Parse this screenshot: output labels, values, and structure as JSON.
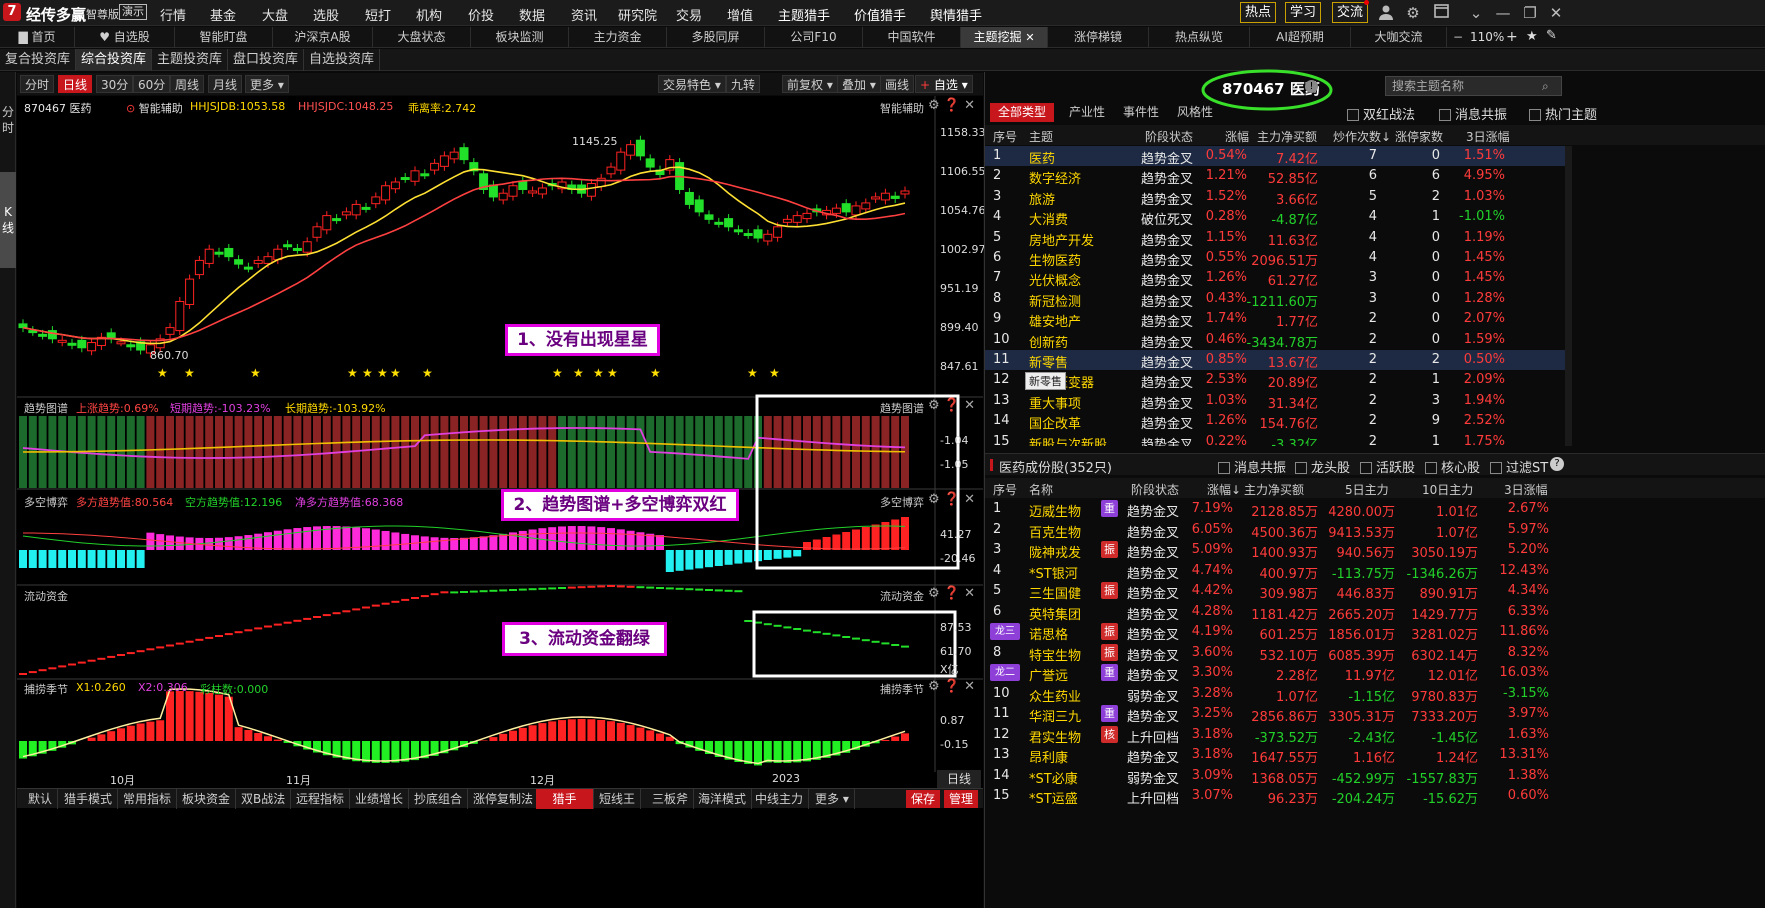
{
  "app": {
    "logo": "7",
    "name": "经传多赢",
    "edition": "智尊版",
    "demo": "演示"
  },
  "menu": [
    "行情",
    "基金",
    "大盘",
    "选股",
    "短打",
    "机构",
    "价投",
    "数据",
    "资讯",
    "研究院",
    "交易",
    "增值",
    "主题猎手",
    "价值猎手",
    "舆情猎手"
  ],
  "right_buttons": [
    "热点",
    "学习",
    "交流"
  ],
  "tabs": [
    "首页",
    "自选股",
    "智能盯盘",
    "沪深京A股",
    "大盘状态",
    "板块监测",
    "主力资金",
    "多股同屏",
    "公司F10",
    "中国软件",
    "主题挖掘",
    "涨停梯镜",
    "热点纵览",
    "AI超预期",
    "大咖交流"
  ],
  "active_tab": "主题挖掘",
  "zoom": "110%",
  "subtabs": [
    "复合投资库",
    "综合投资库",
    "主题投资库",
    "盘口投资库",
    "自选投资库"
  ],
  "active_subtab": "综合投资库",
  "left_rail": [
    "分时",
    "K线"
  ],
  "chart_toolbar": {
    "left": [
      "分时",
      "日线",
      "30分",
      "60分",
      "周线",
      "月线",
      "更多"
    ],
    "right": [
      "交易特色",
      "九转",
      "前复权",
      "叠加",
      "画线",
      "自选"
    ]
  },
  "main_panel": {
    "stock": "870467 医药",
    "assist": "智能辅助",
    "ind1": "HHJSJDB:1053.58",
    "ind2": "HHJSJDC:1048.25",
    "ind3": "乖离率:2.742",
    "title_right": "智能辅助",
    "prices": [
      "1158.33",
      "1106.55",
      "1054.76",
      "1002.97",
      "951.19",
      "899.40",
      "847.61"
    ],
    "high": "1145.25",
    "low": "860.70"
  },
  "trend_panel": {
    "name": "趋势图谱",
    "up": "上涨趋势:0.69%",
    "short": "短期趋势:-103.23%",
    "long": "长期趋势:-103.92%",
    "title_right": "趋势图谱",
    "ticks": [
      "-1.04",
      "-1.05"
    ]
  },
  "game_panel": {
    "name": "多空博弈",
    "bull": "多方趋势值:80.564",
    "bear": "空方趋势值:12.196",
    "net": "净多方趋势值:68.368",
    "title_right": "多空博弈",
    "ticks": [
      "41.27",
      "-20.46"
    ]
  },
  "flow_panel": {
    "name": "流动资金",
    "title_right": "流动资金",
    "ticks": [
      "87.53",
      "61.70"
    ],
    "unit": "X亿"
  },
  "season_panel": {
    "name": "捕捞季节",
    "x1": "X1:0.260",
    "x2": "X2:0.306",
    "bars": "彩柱数:0.000",
    "title_right": "捕捞季节",
    "ticks": [
      "0.87",
      "-0.15"
    ]
  },
  "xaxis": [
    "10月",
    "11月",
    "12月",
    "2023"
  ],
  "xaxis_right": "日线",
  "annotations": [
    "1、没有出现星星",
    "2、趋势图谱+多空博弈双红",
    "3、流动资金翻绿"
  ],
  "bottom_tabs": [
    "默认",
    "猎手模式",
    "常用指标",
    "板块资金",
    "双B战法",
    "远程指标",
    "业绩增长",
    "抄底组合",
    "涨停复制法",
    "猎手",
    "短线王",
    "三板斧",
    "海洋模式",
    "中线主力",
    "更多"
  ],
  "active_bottom_tab": "猎手",
  "bottom_buttons": [
    "保存",
    "管理"
  ],
  "right_panel": {
    "header": "870467 医药",
    "search_placeholder": "搜索主题名称",
    "filters": [
      "全部类型",
      "产业性",
      "事件性",
      "风格性"
    ],
    "checks": [
      "双红战法",
      "消息共振",
      "热门主题"
    ],
    "cols": [
      "序号",
      "主题",
      "阶段状态",
      "涨幅",
      "主力净买额",
      "炒作次数↓",
      "涨停家数",
      "3日涨幅"
    ],
    "rows": [
      [
        "1",
        "医药",
        "趋势金叉",
        "0.54%",
        "7.42亿",
        "7",
        "0",
        "1.51%"
      ],
      [
        "2",
        "数字经济",
        "趋势金叉",
        "1.21%",
        "52.85亿",
        "6",
        "6",
        "4.95%"
      ],
      [
        "3",
        "旅游",
        "趋势金叉",
        "1.52%",
        "3.66亿",
        "5",
        "2",
        "1.03%"
      ],
      [
        "4",
        "大消费",
        "破位死叉",
        "0.28%",
        "-4.87亿",
        "4",
        "1",
        "-1.01%"
      ],
      [
        "5",
        "房地产开发",
        "趋势金叉",
        "1.15%",
        "11.63亿",
        "4",
        "0",
        "1.19%"
      ],
      [
        "6",
        "生物医药",
        "趋势金叉",
        "0.55%",
        "2096.51万",
        "4",
        "0",
        "1.45%"
      ],
      [
        "7",
        "光伏概念",
        "趋势金叉",
        "1.26%",
        "61.27亿",
        "3",
        "0",
        "1.45%"
      ],
      [
        "8",
        "新冠检测",
        "趋势金叉",
        "0.43%",
        "-1211.60万",
        "3",
        "0",
        "1.28%"
      ],
      [
        "9",
        "雄安地产",
        "趋势金叉",
        "1.74%",
        "1.77亿",
        "2",
        "0",
        "2.07%"
      ],
      [
        "10",
        "创新药",
        "趋势金叉",
        "0.46%",
        "-3434.78万",
        "2",
        "0",
        "1.59%"
      ],
      [
        "11",
        "新零售",
        "趋势金叉",
        "0.85%",
        "13.67亿",
        "2",
        "2",
        "0.50%"
      ],
      [
        "12",
        "特高压变器",
        "趋势金叉",
        "2.53%",
        "20.89亿",
        "2",
        "1",
        "2.09%"
      ],
      [
        "13",
        "重大事项",
        "趋势金叉",
        "1.03%",
        "31.34亿",
        "2",
        "3",
        "1.94%"
      ],
      [
        "14",
        "国企改革",
        "趋势金叉",
        "1.26%",
        "154.76亿",
        "2",
        "9",
        "2.52%"
      ],
      [
        "15",
        "新股与次新股",
        "趋势金叉",
        "0.22%",
        "-3.32亿",
        "2",
        "1",
        "1.75%"
      ]
    ],
    "tooltip": "新零售",
    "comp_title": "医药成份股(352只)",
    "comp_checks": [
      "消息共振",
      "龙头股",
      "活跃股",
      "核心股",
      "过滤ST"
    ],
    "comp_cols": [
      "序号",
      "名称",
      "阶段状态",
      "涨幅↓",
      "主力净买额",
      "5日主力",
      "10日主力",
      "3日涨幅"
    ],
    "comp_rows": [
      [
        "1",
        "迈威生物",
        "重",
        "趋势金叉",
        "7.19%",
        "2128.85万",
        "4280.00万",
        "1.01亿",
        "2.67%"
      ],
      [
        "2",
        "百克生物",
        "",
        "趋势金叉",
        "6.05%",
        "4500.36万",
        "9413.53万",
        "1.07亿",
        "5.97%"
      ],
      [
        "3",
        "陇神戎发",
        "振",
        "趋势金叉",
        "5.09%",
        "1400.93万",
        "940.56万",
        "3050.19万",
        "5.20%"
      ],
      [
        "4",
        "*ST银河",
        "",
        "趋势金叉",
        "4.74%",
        "400.97万",
        "-113.75万",
        "-1346.26万",
        "12.43%"
      ],
      [
        "5",
        "三生国健",
        "振",
        "趋势金叉",
        "4.42%",
        "309.98万",
        "446.83万",
        "890.91万",
        "4.34%"
      ],
      [
        "6",
        "英特集团",
        "",
        "趋势金叉",
        "4.28%",
        "1181.42万",
        "2665.20万",
        "1429.77万",
        "6.33%"
      ],
      [
        "7",
        "诺思格",
        "振",
        "趋势金叉",
        "4.19%",
        "601.25万",
        "1856.01万",
        "3281.02万",
        "11.86%"
      ],
      [
        "8",
        "特宝生物",
        "振",
        "趋势金叉",
        "3.60%",
        "532.10万",
        "6085.39万",
        "6302.14万",
        "8.32%"
      ],
      [
        "9",
        "广誉远",
        "重",
        "趋势金叉",
        "3.30%",
        "2.28亿",
        "11.97亿",
        "12.01亿",
        "16.03%"
      ],
      [
        "10",
        "众生药业",
        "",
        "弱势金叉",
        "3.28%",
        "1.07亿",
        "-1.15亿",
        "9780.83万",
        "-3.15%"
      ],
      [
        "11",
        "华润三九",
        "重",
        "趋势金叉",
        "3.25%",
        "2856.86万",
        "3305.31万",
        "7333.20万",
        "3.97%"
      ],
      [
        "12",
        "君实生物",
        "核",
        "上升回档",
        "3.18%",
        "-373.52万",
        "-2.43亿",
        "-1.45亿",
        "1.63%"
      ],
      [
        "13",
        "昂利康",
        "",
        "趋势金叉",
        "3.18%",
        "1647.55万",
        "1.16亿",
        "1.24亿",
        "13.31%"
      ],
      [
        "14",
        "*ST必康",
        "",
        "弱势金叉",
        "3.09%",
        "1368.05万",
        "-452.99万",
        "-1557.83万",
        "1.38%"
      ],
      [
        "15",
        "*ST运盛",
        "",
        "上升回档",
        "3.07%",
        "96.23万",
        "-204.24万",
        "-15.62万",
        "0.60%"
      ]
    ],
    "dragon_tags": [
      "龙三",
      "龙二"
    ]
  }
}
